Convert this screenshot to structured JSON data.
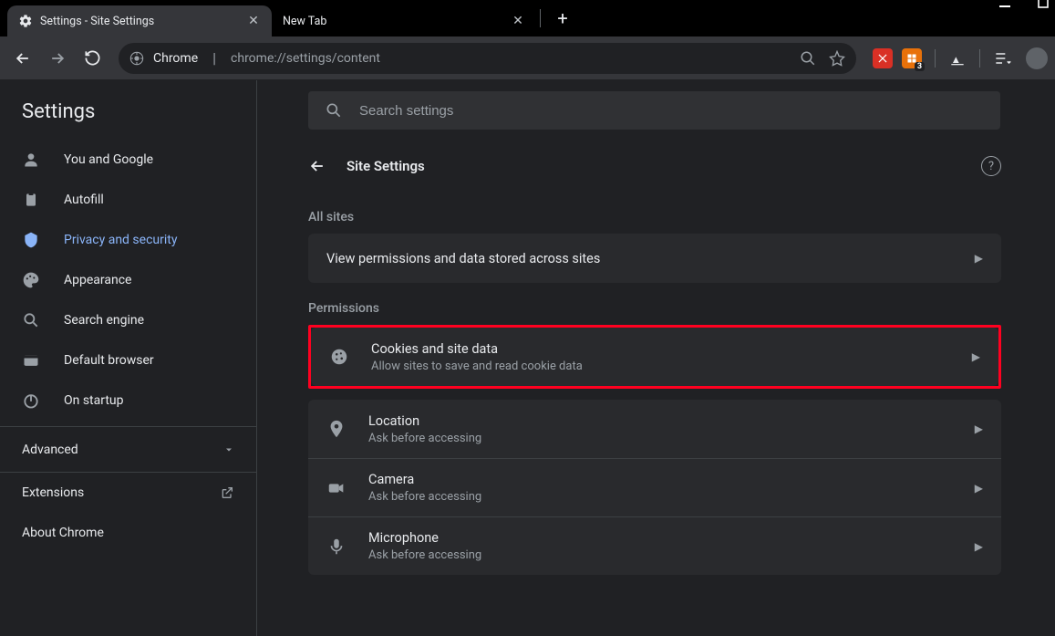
{
  "window": {
    "tabs": [
      {
        "title": "Settings - Site Settings",
        "active": true
      },
      {
        "title": "New Tab",
        "active": false
      }
    ]
  },
  "toolbar": {
    "origin_label": "Chrome",
    "url": "chrome://settings/content",
    "extension_badge": "3"
  },
  "sidebar": {
    "app_title": "Settings",
    "items": [
      {
        "label": "You and Google"
      },
      {
        "label": "Autofill"
      },
      {
        "label": "Privacy and security",
        "active": true
      },
      {
        "label": "Appearance"
      },
      {
        "label": "Search engine"
      },
      {
        "label": "Default browser"
      },
      {
        "label": "On startup"
      }
    ],
    "advanced_label": "Advanced",
    "extensions_label": "Extensions",
    "about_label": "About Chrome"
  },
  "search": {
    "placeholder": "Search settings"
  },
  "page": {
    "title": "Site Settings",
    "section_allsites_label": "All sites",
    "allsites_row": "View permissions and data stored across sites",
    "section_permissions_label": "Permissions",
    "permissions": [
      {
        "title": "Cookies and site data",
        "sub": "Allow sites to save and read cookie data",
        "highlighted": true
      },
      {
        "title": "Location",
        "sub": "Ask before accessing"
      },
      {
        "title": "Camera",
        "sub": "Ask before accessing"
      },
      {
        "title": "Microphone",
        "sub": "Ask before accessing"
      }
    ]
  }
}
